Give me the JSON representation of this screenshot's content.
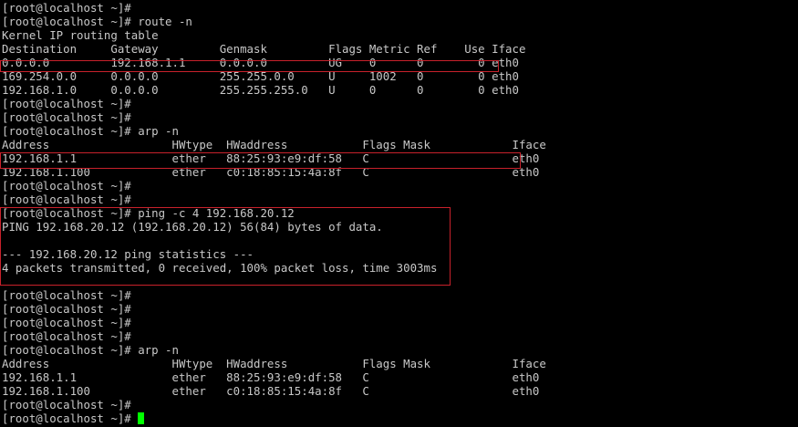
{
  "terminal": {
    "lines": [
      "[root@localhost ~]#",
      "[root@localhost ~]# route -n",
      "Kernel IP routing table",
      "Destination     Gateway         Genmask         Flags Metric Ref    Use Iface",
      "0.0.0.0         192.168.1.1     0.0.0.0         UG    0      0        0 eth0",
      "169.254.0.0     0.0.0.0         255.255.0.0     U     1002   0        0 eth0",
      "192.168.1.0     0.0.0.0         255.255.255.0   U     0      0        0 eth0",
      "[root@localhost ~]#",
      "[root@localhost ~]#",
      "[root@localhost ~]# arp -n",
      "Address                  HWtype  HWaddress           Flags Mask            Iface",
      "192.168.1.1              ether   88:25:93:e9:df:58   C                     eth0",
      "192.168.1.100            ether   c0:18:85:15:4a:8f   C                     eth0",
      "[root@localhost ~]#",
      "[root@localhost ~]#",
      "[root@localhost ~]# ping -c 4 192.168.20.12",
      "PING 192.168.20.12 (192.168.20.12) 56(84) bytes of data.",
      "",
      "--- 192.168.20.12 ping statistics ---",
      "4 packets transmitted, 0 received, 100% packet loss, time 3003ms",
      "",
      "[root@localhost ~]#",
      "[root@localhost ~]#",
      "[root@localhost ~]#",
      "[root@localhost ~]#",
      "[root@localhost ~]# arp -n",
      "Address                  HWtype  HWaddress           Flags Mask            Iface",
      "192.168.1.1              ether   88:25:93:e9:df:58   C                     eth0",
      "192.168.1.100            ether   c0:18:85:15:4a:8f   C                     eth0",
      "[root@localhost ~]#",
      "[root@localhost ~]# "
    ],
    "cursor_color": "#00ff00",
    "highlight_color": "#c8212b"
  }
}
